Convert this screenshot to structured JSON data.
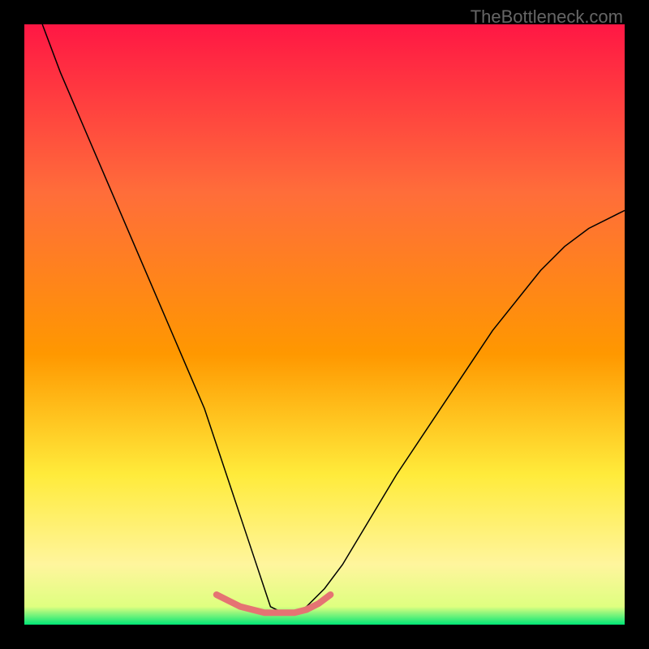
{
  "watermark": "TheBottleneck.com",
  "chart_data": {
    "type": "line",
    "title": "",
    "xlabel": "",
    "ylabel": "",
    "xlim": [
      0,
      100
    ],
    "ylim": [
      0,
      100
    ],
    "background_gradient": {
      "top": "#ff1744",
      "upper_mid": "#ff9800",
      "mid": "#ffeb3b",
      "lower_mid": "#fff59d",
      "bottom": "#00e676"
    },
    "series": [
      {
        "name": "curve",
        "type": "line",
        "color": "#000000",
        "width": 1.5,
        "x": [
          3,
          6,
          9,
          12,
          15,
          18,
          21,
          24,
          27,
          30,
          32,
          34,
          36,
          38,
          40,
          41,
          43,
          45,
          47,
          50,
          53,
          56,
          59,
          62,
          66,
          70,
          74,
          78,
          82,
          86,
          90,
          94,
          98,
          100
        ],
        "y": [
          100,
          92,
          85,
          78,
          71,
          64,
          57,
          50,
          43,
          36,
          30,
          24,
          18,
          12,
          6,
          3,
          2,
          2,
          3,
          6,
          10,
          15,
          20,
          25,
          31,
          37,
          43,
          49,
          54,
          59,
          63,
          66,
          68,
          69
        ]
      },
      {
        "name": "highlight-band",
        "type": "line",
        "color": "#e57373",
        "width": 8,
        "x": [
          32,
          34,
          36,
          38,
          40,
          41,
          43,
          45,
          47,
          49,
          51
        ],
        "y": [
          5,
          4,
          3,
          2.5,
          2,
          2,
          2,
          2,
          2.5,
          3.5,
          5
        ]
      }
    ]
  }
}
